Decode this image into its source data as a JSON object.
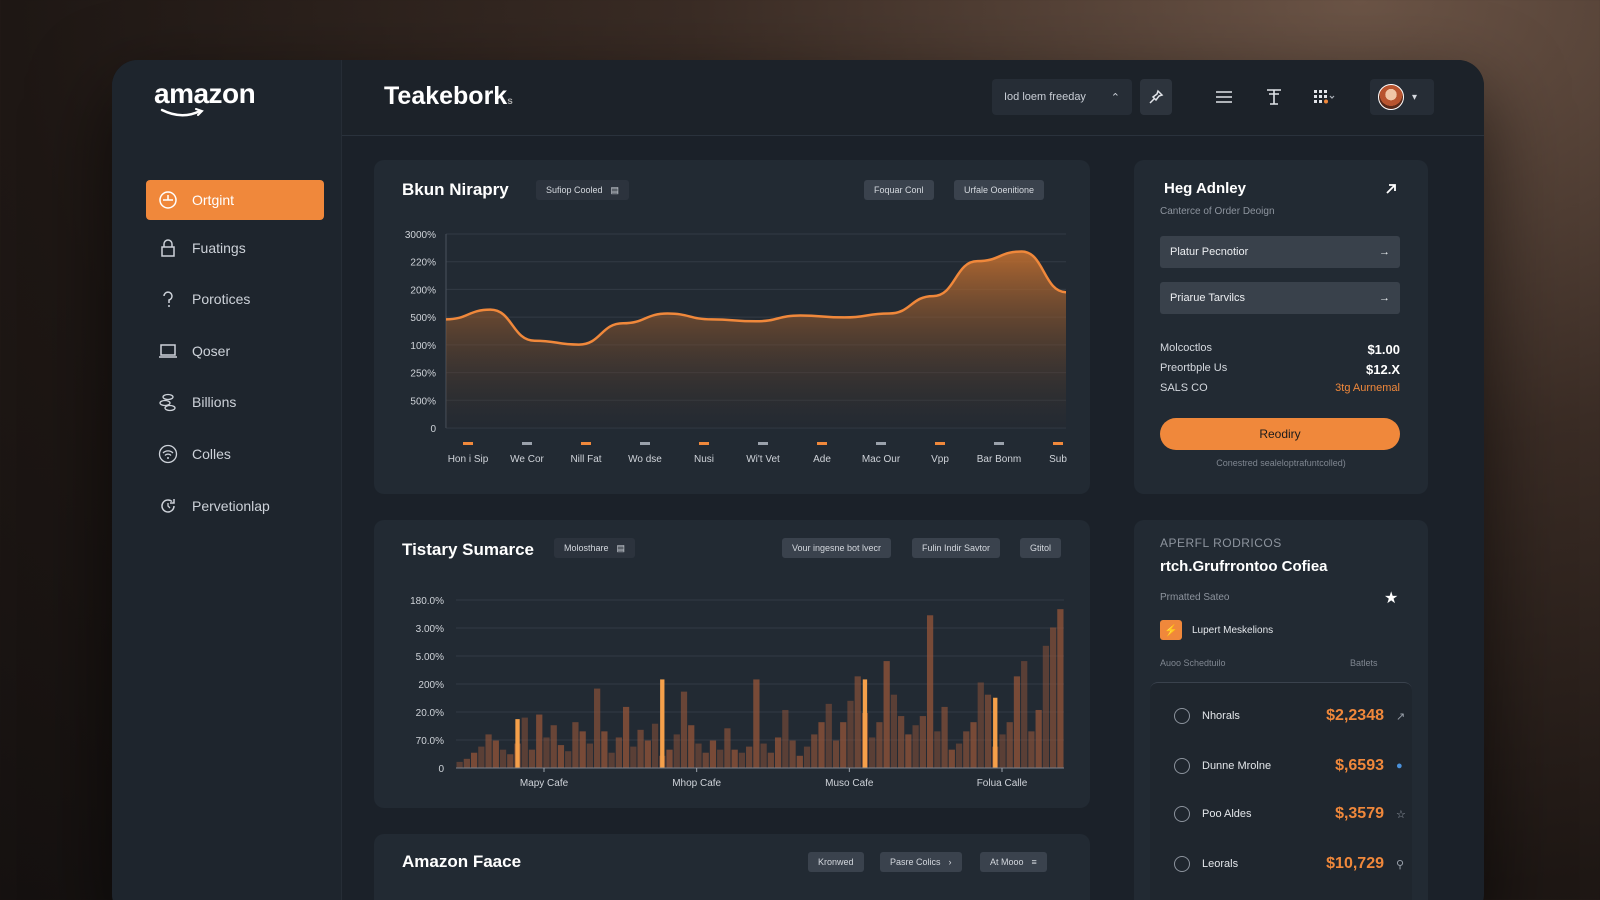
{
  "header": {
    "brand": "amazon",
    "title": "Teakebork",
    "title_suffix": "s",
    "selector_label": "Iod loem freeday"
  },
  "sidebar": {
    "items": [
      {
        "label": "Ortgint",
        "icon": "clock-icon",
        "active": true
      },
      {
        "label": "Fuatings",
        "icon": "lock-icon",
        "active": false
      },
      {
        "label": "Porotices",
        "icon": "question-icon",
        "active": false
      },
      {
        "label": "Qoser",
        "icon": "laptop-icon",
        "active": false
      },
      {
        "label": "Billions",
        "icon": "coins-icon",
        "active": false
      },
      {
        "label": "Colles",
        "icon": "wifi-icon",
        "active": false
      },
      {
        "label": "Pervetionlap",
        "icon": "refresh-icon",
        "active": false
      }
    ]
  },
  "cards": {
    "area": {
      "title": "Bkun Nirapry",
      "chip": "Sufiop Cooled",
      "actions": [
        "Foquar Conl",
        "Urfale Ooenitione"
      ]
    },
    "bars": {
      "title": "Tistary Sumarce",
      "chip": "Molosthare",
      "actions": [
        "Vour ingesne bot lvecr",
        "Fulin Indir Savtor",
        "Gtitol"
      ]
    },
    "bottom": {
      "title": "Amazon Faace",
      "actions": [
        "Kronwed",
        "Pasre Colics",
        "At Mooo"
      ]
    }
  },
  "right_top": {
    "title": "Heg Adnley",
    "subtitle": "Canterce of Order Deoign",
    "rows": [
      "Platur Pecnotior",
      "Priarue Tarvilcs"
    ],
    "kv": [
      {
        "k": "Molcoctlos",
        "v": "$1.00"
      },
      {
        "k": "Preortbple Us",
        "v": "$12.X"
      },
      {
        "k": "SALS CO",
        "v": "3tg Aurnemal"
      }
    ],
    "button": "Reodiry",
    "note": "Conestred sealeloptrafuntcolled)"
  },
  "right_bottom": {
    "eyebrow": "APERFL RODRICOS",
    "heading": "rtch.Grufrrontoo Cofiea",
    "sub": "Prmatted Sateo",
    "feature": "Lupert Meskelions",
    "col_left": "Auoo  Schedtuilo",
    "col_right": "Batlets",
    "rows": [
      {
        "name": "Nhorals",
        "value": "$2,2348",
        "icon": "arrow-icon"
      },
      {
        "name": "Dunne Mrolne",
        "value": "$,6593",
        "icon": "info-icon"
      },
      {
        "name": "Poo Aldes",
        "value": "$,3579",
        "icon": "tag-icon"
      },
      {
        "name": "Leorals",
        "value": "$10,729",
        "icon": "search-icon"
      }
    ]
  },
  "colors": {
    "accent": "#f0883b",
    "panel": "#222a33",
    "bg": "#1b2129"
  },
  "chart_data": [
    {
      "type": "area",
      "ytick_labels": [
        "3000%",
        "220%",
        "200%",
        "500%",
        "100%",
        "250%",
        "500%",
        "0"
      ],
      "categories": [
        "Hon i Sip",
        "We Cor",
        "Nill Fat",
        "Wo   dse",
        "Nusi",
        "Wi't Vet",
        "Ade",
        "Mac Our",
        "Vpp",
        "Bar Bonm",
        "Sub"
      ],
      "values": [
        5.6,
        6.1,
        4.5,
        4.3,
        5.4,
        5.9,
        5.6,
        5.5,
        5.8,
        5.7,
        5.9,
        6.8,
        8.6,
        9.1,
        7.0
      ],
      "ylim": [
        0,
        10
      ]
    },
    {
      "type": "bar",
      "ytick_labels": [
        "180.0%",
        "3.00%",
        "5.00%",
        "200%",
        "20.0%",
        "70.0%",
        "0"
      ],
      "categories": [
        "Mapy Cafe",
        "Mhop Cafe",
        "Muso Cafe",
        "Folua Calle"
      ],
      "values": [
        4,
        6,
        10,
        14,
        22,
        18,
        12,
        9,
        16,
        33,
        12,
        35,
        20,
        28,
        15,
        11,
        30,
        24,
        16,
        52,
        24,
        10,
        20,
        40,
        14,
        25,
        18,
        29,
        8,
        12,
        22,
        50,
        28,
        16,
        10,
        18,
        12,
        26,
        12,
        10,
        14,
        58,
        16,
        10,
        20,
        38,
        18,
        8,
        14,
        22,
        30,
        42,
        18,
        30,
        44,
        60,
        36,
        20,
        30,
        70,
        48,
        34,
        22,
        28,
        34,
        100,
        24,
        40,
        12,
        16,
        24,
        30,
        56,
        48,
        14,
        22,
        30,
        60,
        70,
        24,
        38,
        80,
        92,
        104
      ],
      "highlights": [
        8,
        28,
        56,
        74
      ],
      "highlight_values": [
        32,
        58,
        58,
        46
      ],
      "ylim": [
        0,
        110
      ]
    }
  ]
}
